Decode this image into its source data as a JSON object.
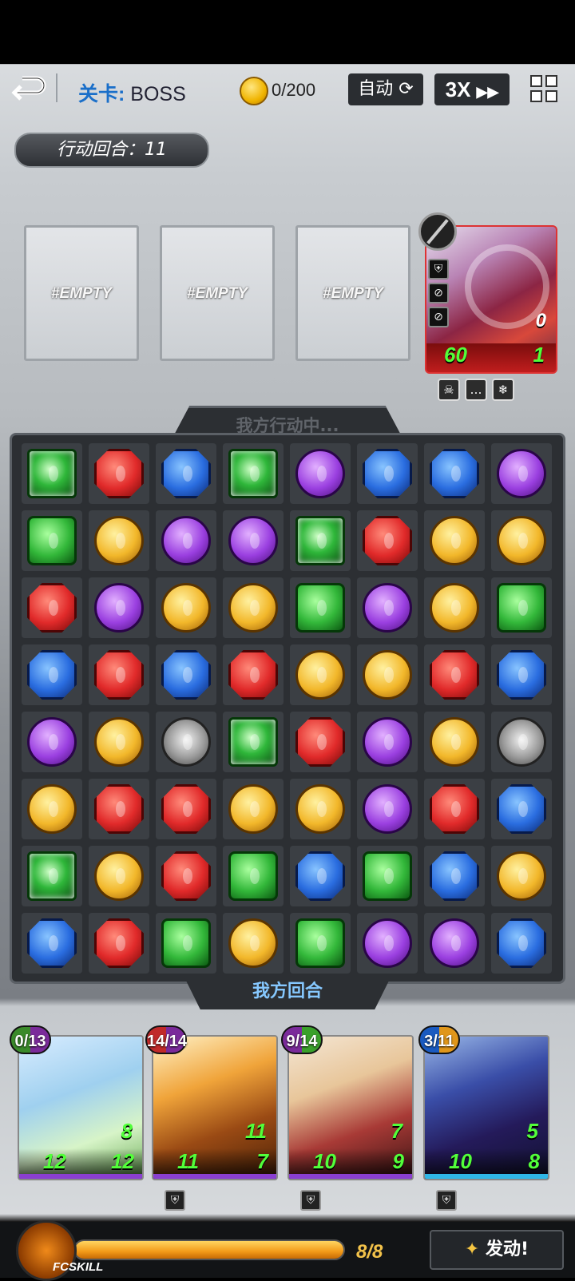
{
  "topbar": {
    "stage_key": "关卡:",
    "stage_value": "BOSS",
    "coins": "0/200",
    "auto_label": "自动",
    "speed_label": "3X"
  },
  "turn": {
    "label": "行动回合：11"
  },
  "slots": [
    "#EMPTY",
    "#EMPTY",
    "#EMPTY"
  ],
  "enemy": {
    "shield": "0",
    "attack": "60",
    "hp": "1"
  },
  "board": {
    "status_top": "我方行动中...",
    "status_bottom": "我方回合",
    "rows": [
      [
        "sgreen",
        "red",
        "blue",
        "sgreen",
        "purple",
        "blue",
        "blue",
        "purple"
      ],
      [
        "green",
        "yellow",
        "purple",
        "purple",
        "sgreen",
        "red",
        "yellow",
        "yellow"
      ],
      [
        "red",
        "purple",
        "yellow",
        "yellow",
        "green",
        "purple",
        "yellow",
        "green"
      ],
      [
        "blue",
        "red",
        "blue",
        "red",
        "yellow",
        "yellow",
        "red",
        "blue"
      ],
      [
        "purple",
        "yellow",
        "sword",
        "sgreen",
        "red",
        "purple",
        "yellow",
        "sword"
      ],
      [
        "yellow",
        "red",
        "red",
        "yellow",
        "yellow",
        "purple",
        "red",
        "blue"
      ],
      [
        "sgreen",
        "yellow",
        "red",
        "green",
        "blue",
        "green",
        "blue",
        "yellow"
      ],
      [
        "blue",
        "red",
        "green",
        "yellow",
        "green",
        "purple",
        "purple",
        "blue"
      ]
    ]
  },
  "heroes": [
    {
      "energy": "0/13",
      "shield": "8",
      "attack": "12",
      "hp": "12",
      "color": "#8a3fd0"
    },
    {
      "energy": "14/14",
      "shield": "11",
      "attack": "11",
      "hp": "7",
      "color": "#8a3fd0"
    },
    {
      "energy": "9/14",
      "shield": "7",
      "attack": "10",
      "hp": "9",
      "color": "#8a3fd0"
    },
    {
      "energy": "3/11",
      "shield": "5",
      "attack": "10",
      "hp": "8",
      "color": "#2fb6e6"
    }
  ],
  "fcskill": {
    "label": "FCSKILL",
    "count": "8/8",
    "progress": 1.0,
    "activate_label": "发动!"
  }
}
